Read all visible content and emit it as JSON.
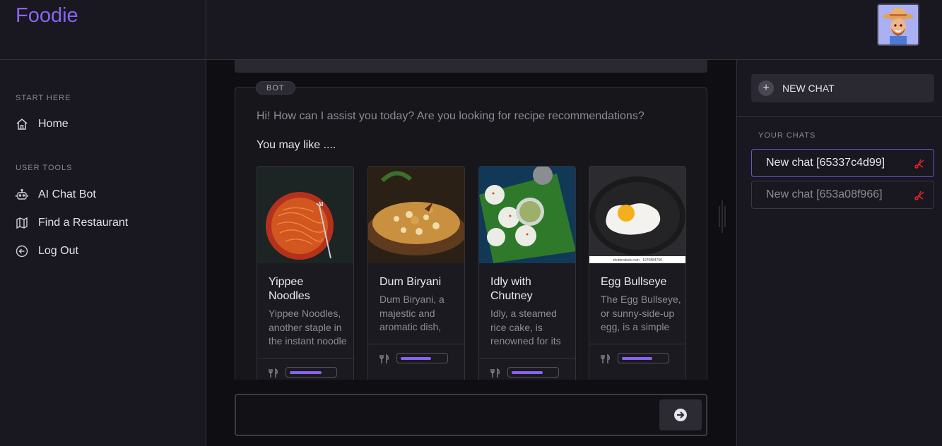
{
  "app": {
    "brand": "Foodie"
  },
  "sidebar": {
    "sections": [
      {
        "label": "START HERE",
        "items": [
          {
            "label": "Home",
            "icon": "home-icon"
          }
        ]
      },
      {
        "label": "USER TOOLS",
        "items": [
          {
            "label": "AI Chat Bot",
            "icon": "robot-icon"
          },
          {
            "label": "Find a Restaurant",
            "icon": "map-icon"
          },
          {
            "label": "Log Out",
            "icon": "arrow-left-circle-icon"
          }
        ]
      }
    ]
  },
  "chat": {
    "badge": "BOT",
    "greeting": "Hi! How can I assist you today? Are you looking for recipe recommendations?",
    "suggestion_heading": "You may like ....",
    "cards": [
      {
        "title": "Yippee Noodles",
        "description": "Yippee Noodles, another staple in the instant noodle category...",
        "image": "noodles",
        "rating": 0.72
      },
      {
        "title": "Dum Biryani",
        "description": "Dum Biryani, a majestic and aromatic dish, cooked slowly...",
        "image": "biryani",
        "rating": 0.68
      },
      {
        "title": "Idly with Chutney",
        "description": "Idly, a steamed rice cake, is renowned for its softness...",
        "image": "idly",
        "rating": 0.7
      },
      {
        "title": "Egg Bullseye",
        "description": "The Egg Bullseye, or sunny-side-up egg, is a simple dish...",
        "image": "egg",
        "rating": 0.68,
        "image_caption": "shutterstock.com · 1970884750"
      }
    ],
    "input": {
      "placeholder": ""
    }
  },
  "right_panel": {
    "new_chat_label": "NEW CHAT",
    "your_chats_label": "YOUR CHATS",
    "chats": [
      {
        "label": "New chat [65337c4d99]",
        "active": true
      },
      {
        "label": "New chat [653a08f966]",
        "active": false
      }
    ]
  },
  "colors": {
    "accent": "#8a63f0",
    "background": "#19171f",
    "delete": "#e0262c"
  }
}
